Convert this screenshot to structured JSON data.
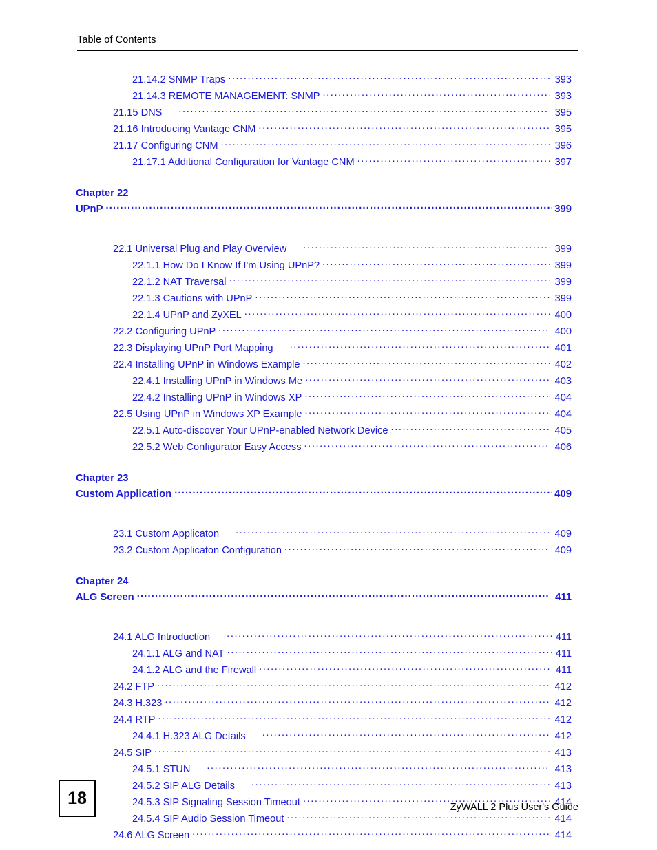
{
  "header": {
    "title": "Table of Contents"
  },
  "footer": {
    "page_number": "18",
    "guide_title": "ZyWALL 2 Plus User's Guide"
  },
  "colors": {
    "entry_blue": "#1a19d6",
    "rule_black": "#000000",
    "page_background": "#ffffff"
  },
  "toc": {
    "groups": [
      {
        "type": "entries",
        "entries": [
          {
            "label": "21.14.2 SNMP Traps",
            "page": "393",
            "level": 3,
            "gap": false,
            "tight": false
          },
          {
            "label": "21.14.3 REMOTE MANAGEMENT: SNMP",
            "page": "393",
            "level": 3,
            "gap": false,
            "tight": false
          },
          {
            "label": "21.15 DNS",
            "page": "395",
            "level": 2,
            "gap": true,
            "tight": false
          },
          {
            "label": "21.16 Introducing Vantage CNM",
            "page": "395",
            "level": 2,
            "gap": false,
            "tight": false
          },
          {
            "label": "21.17 Configuring CNM",
            "page": "396",
            "level": 2,
            "gap": false,
            "tight": false
          },
          {
            "label": "21.17.1 Additional Configuration for Vantage CNM",
            "page": "397",
            "level": 3,
            "gap": false,
            "tight": false
          }
        ]
      },
      {
        "type": "chapter",
        "chapter_label": "Chapter  22",
        "title": "UPnP",
        "page": "399",
        "tight": true,
        "entries": [
          {
            "label": "22.1 Universal Plug and Play Overview",
            "page": "399",
            "level": 2,
            "gap": true,
            "tight": false
          },
          {
            "label": "22.1.1 How Do I Know If I'm Using UPnP?",
            "page": "399",
            "level": 3,
            "gap": false,
            "tight": false
          },
          {
            "label": "22.1.2 NAT Traversal",
            "page": "399",
            "level": 3,
            "gap": false,
            "tight": false
          },
          {
            "label": "22.1.3 Cautions with UPnP",
            "page": "399",
            "level": 3,
            "gap": false,
            "tight": false
          },
          {
            "label": "22.1.4 UPnP and ZyXEL",
            "page": "400",
            "level": 3,
            "gap": false,
            "tight": false
          },
          {
            "label": "22.2 Configuring UPnP",
            "page": "400",
            "level": 2,
            "gap": false,
            "tight": false
          },
          {
            "label": "22.3 Displaying UPnP Port Mapping",
            "page": "401",
            "level": 2,
            "gap": true,
            "tight": false
          },
          {
            "label": "22.4 Installing UPnP in Windows Example",
            "page": "402",
            "level": 2,
            "gap": false,
            "tight": false
          },
          {
            "label": "22.4.1 Installing UPnP in Windows Me",
            "page": "403",
            "level": 3,
            "gap": false,
            "tight": false
          },
          {
            "label": "22.4.2 Installing UPnP in Windows XP",
            "page": "404",
            "level": 3,
            "gap": false,
            "tight": false
          },
          {
            "label": "22.5 Using UPnP in Windows XP Example",
            "page": "404",
            "level": 2,
            "gap": false,
            "tight": false
          },
          {
            "label": "22.5.1 Auto-discover Your UPnP-enabled Network Device",
            "page": "405",
            "level": 3,
            "gap": false,
            "tight": false
          },
          {
            "label": "22.5.2 Web Configurator Easy Access",
            "page": "406",
            "level": 3,
            "gap": false,
            "tight": false
          }
        ]
      },
      {
        "type": "chapter",
        "chapter_label": "Chapter  23",
        "title": "Custom Application",
        "page": "409",
        "tight": true,
        "entries": [
          {
            "label": "23.1 Custom Applicaton",
            "page": "409",
            "level": 2,
            "gap": true,
            "tight": false
          },
          {
            "label": "23.2 Custom Applicaton Configuration",
            "page": "409",
            "level": 2,
            "gap": false,
            "tight": false
          }
        ]
      },
      {
        "type": "chapter",
        "chapter_label": "Chapter  24",
        "title": "ALG Screen",
        "page": "411",
        "tight": false,
        "entries": [
          {
            "label": "24.1 ALG Introduction",
            "page": "411",
            "level": 2,
            "gap": true,
            "tight": true
          },
          {
            "label": "24.1.1 ALG and NAT",
            "page": "411",
            "level": 3,
            "gap": false,
            "tight": true
          },
          {
            "label": "24.1.2 ALG and the Firewall",
            "page": "411",
            "level": 3,
            "gap": false,
            "tight": true
          },
          {
            "label": "24.2 FTP",
            "page": "412",
            "level": 2,
            "gap": false,
            "tight": false
          },
          {
            "label": "24.3 H.323",
            "page": "412",
            "level": 2,
            "gap": false,
            "tight": false
          },
          {
            "label": "24.4 RTP",
            "page": "412",
            "level": 2,
            "gap": false,
            "tight": false
          },
          {
            "label": "24.4.1 H.323 ALG Details",
            "page": "412",
            "level": 3,
            "gap": true,
            "tight": false
          },
          {
            "label": "24.5 SIP",
            "page": "413",
            "level": 2,
            "gap": false,
            "tight": false
          },
          {
            "label": "24.5.1 STUN",
            "page": "413",
            "level": 3,
            "gap": true,
            "tight": false
          },
          {
            "label": "24.5.2 SIP ALG Details",
            "page": "413",
            "level": 3,
            "gap": true,
            "tight": false
          },
          {
            "label": "24.5.3 SIP Signaling Session Timeout",
            "page": "414",
            "level": 3,
            "gap": false,
            "tight": false
          },
          {
            "label": "24.5.4 SIP Audio Session Timeout",
            "page": "414",
            "level": 3,
            "gap": false,
            "tight": false
          },
          {
            "label": "24.6 ALG Screen",
            "page": "414",
            "level": 2,
            "gap": false,
            "tight": false
          }
        ]
      }
    ]
  }
}
